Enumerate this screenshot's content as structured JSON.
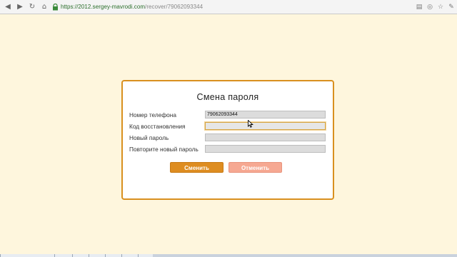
{
  "browser": {
    "url_base": "https://2012.sergey-mavrodi.com",
    "url_path": "/recover/79062093344",
    "nav_icons": [
      "back-icon",
      "forward-icon",
      "reload-icon",
      "home-icon"
    ],
    "extension_icons": [
      "page-icon",
      "reader-icon",
      "gear-icon",
      "wrench-icon"
    ]
  },
  "dialog": {
    "title": "Смена пароля",
    "fields": [
      {
        "label": "Номер телефона",
        "value": "79062093344",
        "focused": false
      },
      {
        "label": "Код восстановления",
        "value": "",
        "focused": true
      },
      {
        "label": "Новый пароль",
        "value": "",
        "focused": false
      },
      {
        "label": "Повторите новый пароль",
        "value": "",
        "focused": false
      }
    ],
    "submit_label": "Сменить",
    "cancel_label": "Отменить"
  },
  "colors": {
    "page_background": "#fef6dd",
    "dialog_border": "#d9901f",
    "submit_button": "#de8d21",
    "cancel_button": "#f6a892",
    "url_secure": "#2a6e2a"
  }
}
